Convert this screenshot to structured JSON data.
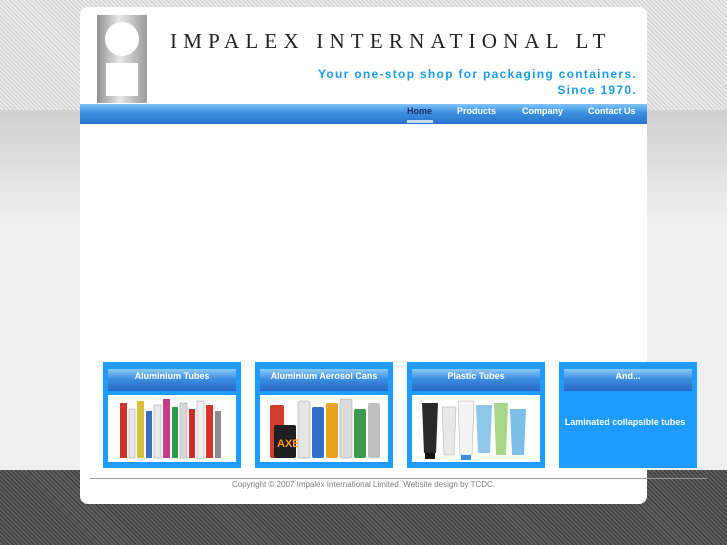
{
  "header": {
    "company_name": "IMPALEX INTERNATIONAL LT",
    "tagline_line1": "Your one-stop shop for packaging containers.",
    "tagline_line2": "Since 1970."
  },
  "nav": {
    "items": [
      {
        "label": "Home",
        "active": true
      },
      {
        "label": "Products"
      },
      {
        "label": "Company"
      },
      {
        "label": "Contact Us"
      }
    ]
  },
  "cards": [
    {
      "title": "Aluminium Tubes",
      "image": "aluminium-tubes-photo"
    },
    {
      "title": "Aluminium Aerosol Cans",
      "image": "aerosol-cans-photo"
    },
    {
      "title": "Plastic Tubes",
      "image": "plastic-tubes-photo"
    },
    {
      "title": "And...",
      "text": "Laminated collapsible tubes"
    }
  ],
  "footer": {
    "copyright": "Copyright © 2007 Impalex International Limited. Website design by TCDC."
  },
  "colors": {
    "accent_blue": "#1e9bff",
    "tagline_blue": "#1a9de6",
    "nav_active": "#1b2f63"
  }
}
